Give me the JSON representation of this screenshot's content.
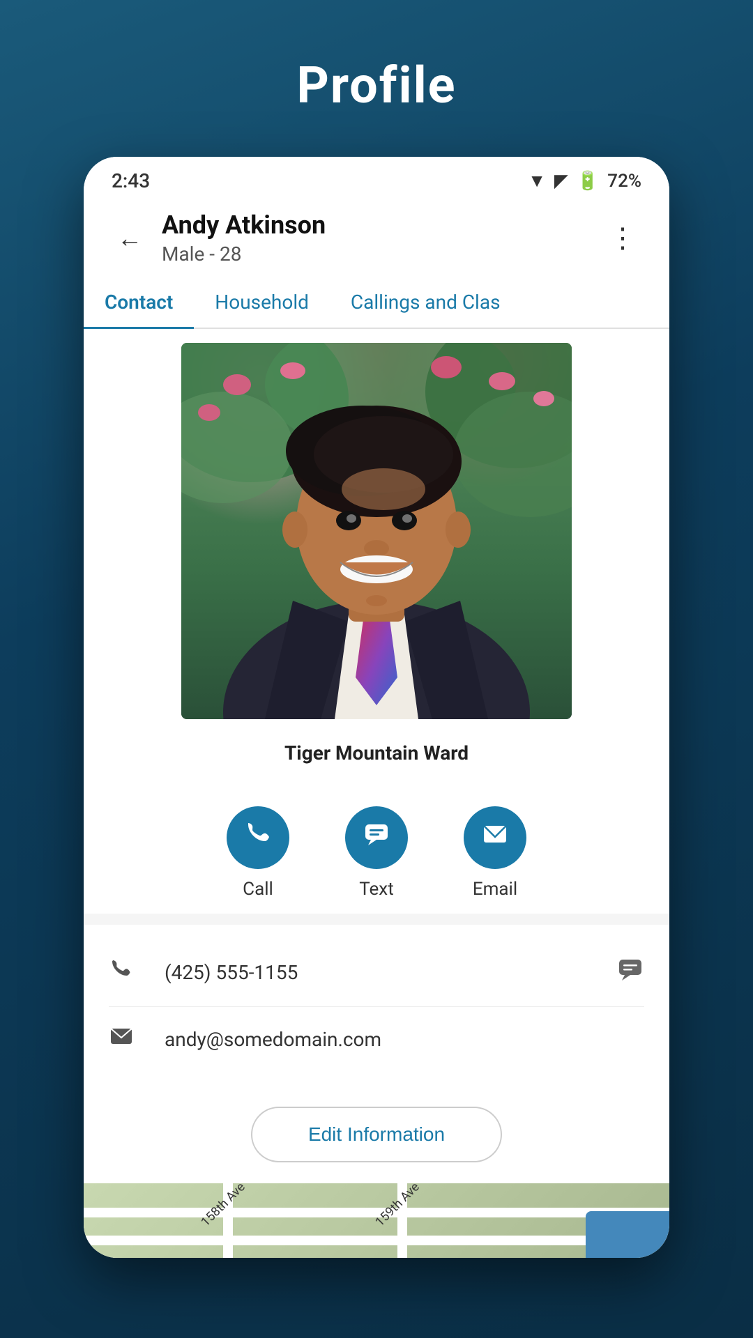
{
  "page": {
    "title": "Profile",
    "background_color": "#0d3d5c"
  },
  "status_bar": {
    "time": "2:43",
    "battery_percent": "72%"
  },
  "header": {
    "person_name": "Andy Atkinson",
    "person_subtitle": "Male - 28",
    "back_label": "back",
    "more_label": "more options"
  },
  "tabs": [
    {
      "label": "Contact",
      "active": true
    },
    {
      "label": "Household",
      "active": false
    },
    {
      "label": "Callings and Clas",
      "active": false
    }
  ],
  "profile": {
    "ward_name": "Tiger Mountain Ward",
    "photo_alt": "Andy Atkinson profile photo"
  },
  "action_buttons": [
    {
      "id": "call",
      "label": "Call",
      "icon": "📞"
    },
    {
      "id": "text",
      "label": "Text",
      "icon": "💬"
    },
    {
      "id": "email",
      "label": "Email",
      "icon": "✉️"
    }
  ],
  "contact_info": [
    {
      "id": "phone",
      "icon": "📞",
      "value": "(425) 555-1155",
      "has_action": true
    },
    {
      "id": "email",
      "icon": "✉️",
      "value": "andy@somedomain.com",
      "has_action": false
    }
  ],
  "edit_button": {
    "label": "Edit Information"
  },
  "map": {
    "road_labels": [
      "158th Ave",
      "159th Ave"
    ]
  }
}
